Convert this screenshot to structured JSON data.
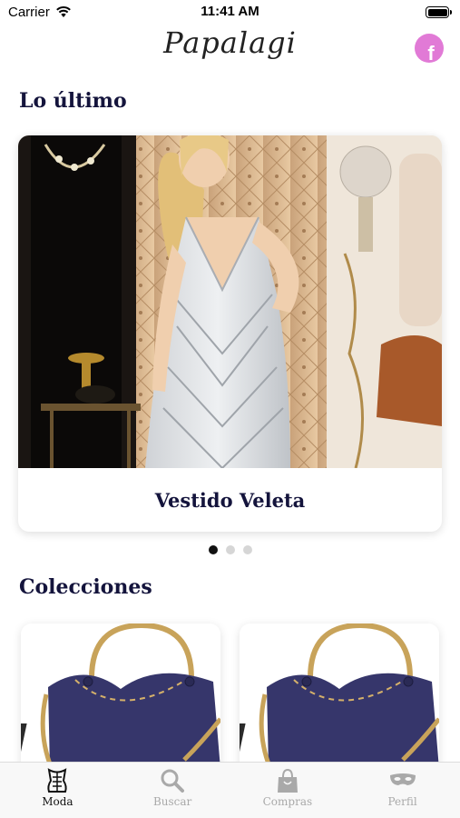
{
  "status_bar": {
    "carrier": "Carrier",
    "time": "11:41 AM",
    "battery_level": 1.0
  },
  "header": {
    "logo_text": "Papalagi",
    "facebook_icon": "facebook-icon",
    "facebook_letter": "f"
  },
  "latest": {
    "title": "Lo último",
    "featured": {
      "name": "Vestido Veleta"
    },
    "pagination": {
      "total": 3,
      "active_index": 0
    }
  },
  "collections": {
    "title": "Colecciones"
  },
  "tab_bar": {
    "items": [
      {
        "label": "Moda",
        "icon": "corset-icon",
        "active": true
      },
      {
        "label": "Buscar",
        "icon": "search-icon",
        "active": false
      },
      {
        "label": "Compras",
        "icon": "shopping-bag-icon",
        "active": false
      },
      {
        "label": "Perfil",
        "icon": "mask-icon",
        "active": false
      }
    ]
  },
  "colors": {
    "heading": "#14143c",
    "accent_facebook": "#e17ad6",
    "bag_body": "#36366b",
    "bag_handle": "#c8a35a",
    "tab_active": "#111111",
    "tab_inactive": "#a9a9a9"
  }
}
